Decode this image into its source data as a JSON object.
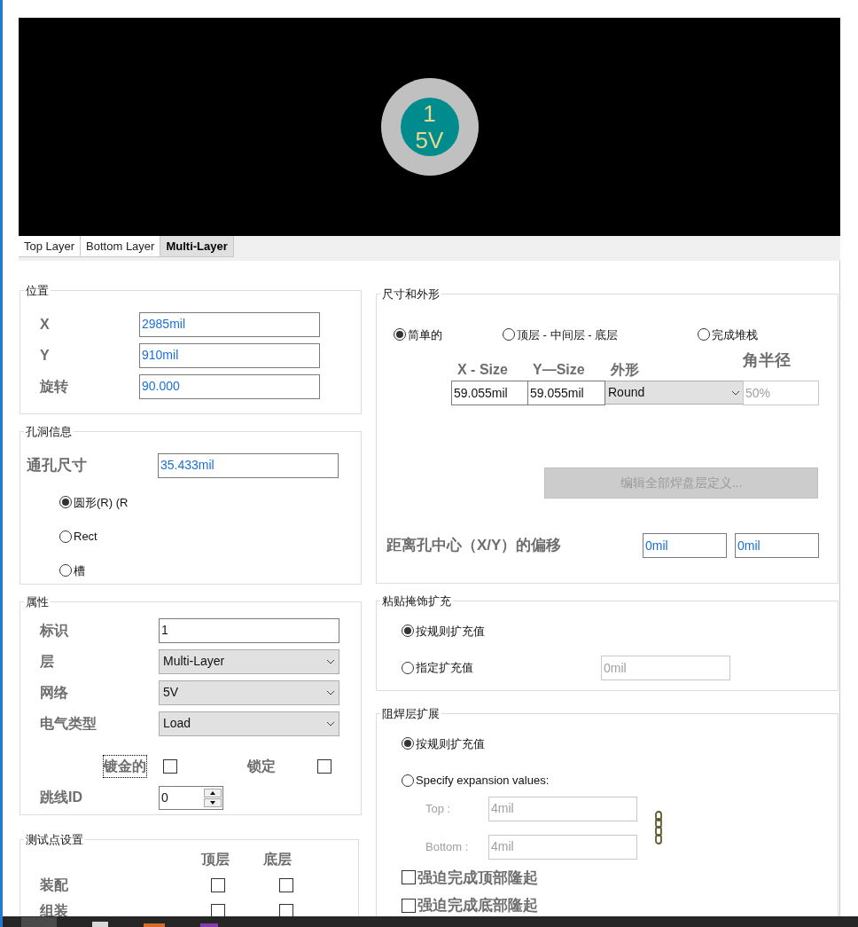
{
  "pad_preview": {
    "number": "1",
    "net": "5V"
  },
  "layer_tabs": [
    {
      "label": "Top Layer",
      "selected": false
    },
    {
      "label": "Bottom Layer",
      "selected": false
    },
    {
      "label": "Multi-Layer",
      "selected": true
    }
  ],
  "position": {
    "title": "位置",
    "fields": [
      {
        "label": "X",
        "value": "2985mil"
      },
      {
        "label": "Y",
        "value": "910mil"
      },
      {
        "label": "旋转",
        "value": "90.000"
      }
    ]
  },
  "hole": {
    "title": "孔洞信息",
    "size_label": "通孔尺寸",
    "size_value": "35.433mil",
    "shapes": [
      {
        "label": "圆形(R) (R",
        "selected": true
      },
      {
        "label": "Rect",
        "selected": false
      },
      {
        "label": "槽",
        "selected": false
      }
    ]
  },
  "properties": {
    "title": "属性",
    "fields": [
      {
        "label": "标识",
        "value": "1",
        "kind": "text"
      },
      {
        "label": "层",
        "value": "Multi-Layer",
        "kind": "select"
      },
      {
        "label": "网络",
        "value": "5V",
        "kind": "select"
      },
      {
        "label": "电气类型",
        "value": "Load",
        "kind": "select"
      }
    ],
    "plated": {
      "label": "镀金的",
      "checked": false,
      "focused": true
    },
    "locked": {
      "label": "锁定",
      "checked": false
    },
    "jumper": {
      "label": "跳线ID",
      "value": "0"
    }
  },
  "testpoint": {
    "title": "测试点设置",
    "columns": [
      "顶层",
      "底层"
    ],
    "rows": [
      {
        "label": "装配",
        "top": false,
        "bottom": false
      },
      {
        "label": "组装",
        "top": false,
        "bottom": false
      }
    ]
  },
  "size_shape": {
    "title": "尺寸和外形",
    "modes": [
      {
        "label": "简单的",
        "selected": true
      },
      {
        "label": "顶层 - 中间层 - 底层",
        "selected": false
      },
      {
        "label": "完成堆栈",
        "selected": false
      }
    ],
    "headers": {
      "x": "X - Size",
      "y": "Y—Size",
      "shape": "外形",
      "corner": "角半径"
    },
    "row": {
      "x": "59.055mil",
      "y": "59.055mil",
      "shape": "Round",
      "corner": "50%",
      "corner_disabled": true
    },
    "edit_button": {
      "label": "编辑全部焊盘层定义...",
      "disabled": true
    },
    "offset": {
      "label": "距离孔中心（X/Y）的偏移",
      "x": "0mil",
      "y": "0mil"
    }
  },
  "paste": {
    "title": "粘贴掩饰扩充",
    "options": [
      {
        "label": "按规则扩充值",
        "selected": true
      },
      {
        "label": "指定扩充值",
        "selected": false
      }
    ],
    "value": "0mil",
    "value_disabled": true
  },
  "solder": {
    "title": "阻焊层扩展",
    "options": [
      {
        "label": "按规则扩充值",
        "selected": true
      },
      {
        "label": "Specify expansion values:",
        "selected": false
      }
    ],
    "fields": [
      {
        "label": "Top :",
        "value": "4mil",
        "disabled": true
      },
      {
        "label": "Bottom :",
        "value": "4mil",
        "disabled": true
      }
    ],
    "checks": [
      {
        "label": "强迫完成顶部隆起",
        "checked": false
      },
      {
        "label": "强迫完成底部隆起",
        "checked": false
      }
    ]
  }
}
